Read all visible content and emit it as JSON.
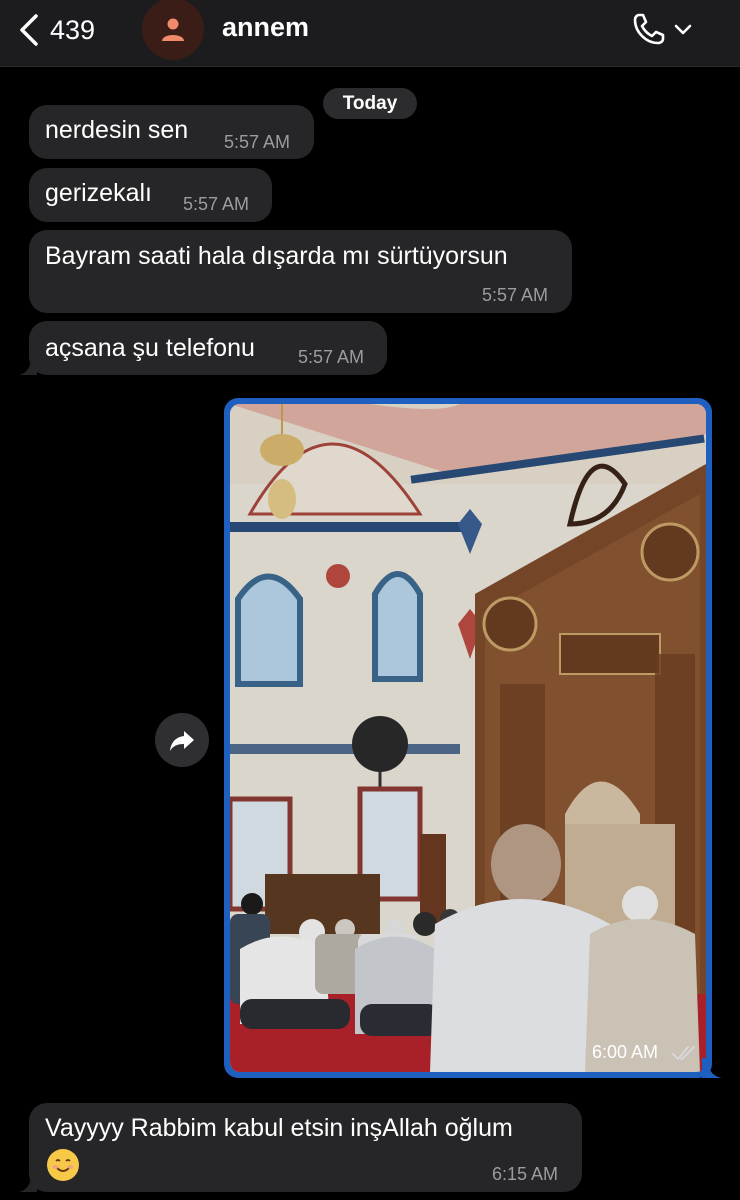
{
  "header": {
    "back_count": "439",
    "contact_name": "annem"
  },
  "date_separator": "Today",
  "messages": [
    {
      "text": "nerdesin sen",
      "time": "5:57 AM"
    },
    {
      "text": "gerizekalı",
      "time": "5:57 AM"
    },
    {
      "text": "Bayram saati hala dışarda mı sürtüyorsun",
      "time": "5:57 AM"
    },
    {
      "text": "açsana şu telefonu",
      "time": "5:57 AM"
    }
  ],
  "photo_message": {
    "time": "6:00 AM",
    "status": "read",
    "accent": "#1f5fbf"
  },
  "last_message": {
    "text": "Vayyyy Rabbim kabul etsin inşAllah oğlum",
    "emoji": "☺️",
    "time": "6:15 AM"
  },
  "icons": {
    "back": "chevron-left-icon",
    "avatar": "person-icon",
    "call": "phone-icon",
    "forward": "forward-icon",
    "read": "double-check-icon"
  },
  "colors": {
    "background": "#000000",
    "incoming_bubble": "#262628",
    "header": "#1c1c1e",
    "avatar_bg": "#3a1d17",
    "avatar_fg": "#f08a6a"
  }
}
